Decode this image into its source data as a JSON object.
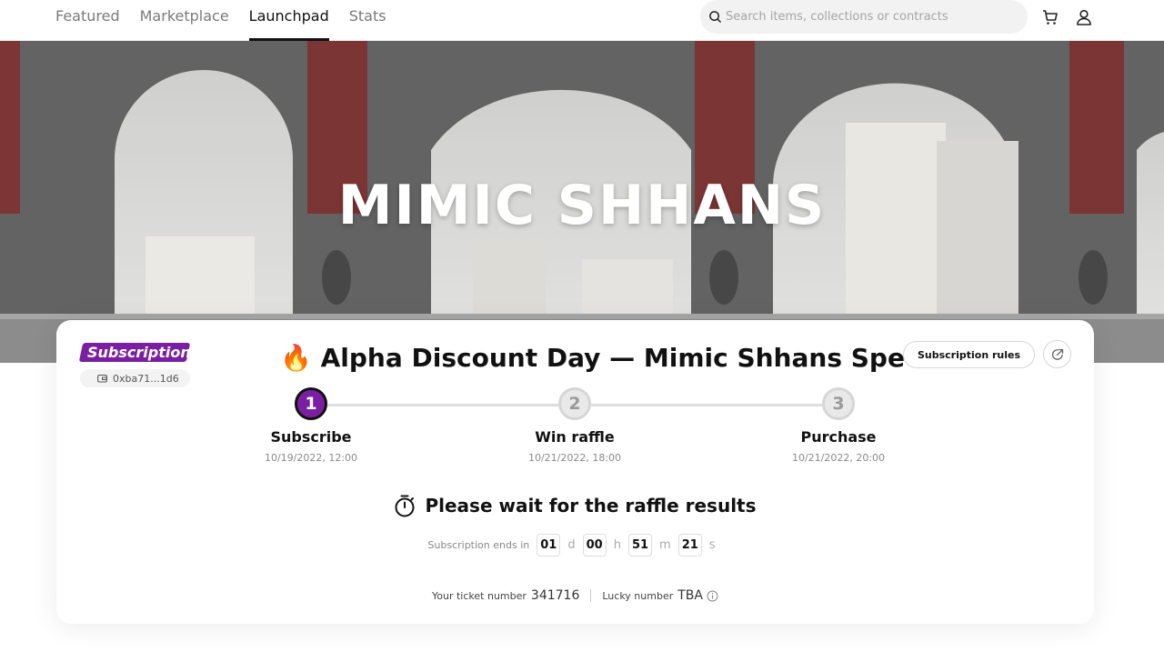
{
  "nav": {
    "items": [
      {
        "label": "Featured",
        "active": false
      },
      {
        "label": "Marketplace",
        "active": false
      },
      {
        "label": "Launchpad",
        "active": true
      },
      {
        "label": "Stats",
        "active": false
      }
    ],
    "search_placeholder": "Search items, collections or contracts",
    "icons": [
      "search-icon",
      "cart-icon",
      "user-icon"
    ]
  },
  "hero": {
    "title": "MIMIC SHHANS"
  },
  "card": {
    "badge": "Subscription",
    "address": "0xba71...1d6",
    "title_icon": "🔥",
    "title": "Alpha Discount Day — Mimic Shhans Special",
    "rules_label": "Subscription rules",
    "steps": [
      {
        "number": "1",
        "label": "Subscribe",
        "date": "10/19/2022, 12:00",
        "active": true
      },
      {
        "number": "2",
        "label": "Win raffle",
        "date": "10/21/2022, 18:00",
        "active": false
      },
      {
        "number": "3",
        "label": "Purchase",
        "date": "10/21/2022, 20:00",
        "active": false
      }
    ],
    "wait_message": "Please wait for the raffle results",
    "countdown": {
      "label": "Subscription ends in",
      "days": "01",
      "days_unit": "d",
      "hours": "00",
      "hours_unit": "h",
      "minutes": "51",
      "minutes_unit": "m",
      "seconds": "21",
      "seconds_unit": "s"
    },
    "ticket_label": "Your ticket number",
    "ticket_number": "341716",
    "lucky_label": "Lucky number",
    "lucky_value": "TBA"
  },
  "colors": {
    "accent": "#7b1fa2",
    "text": "#111111",
    "muted": "#8a8a8a"
  }
}
